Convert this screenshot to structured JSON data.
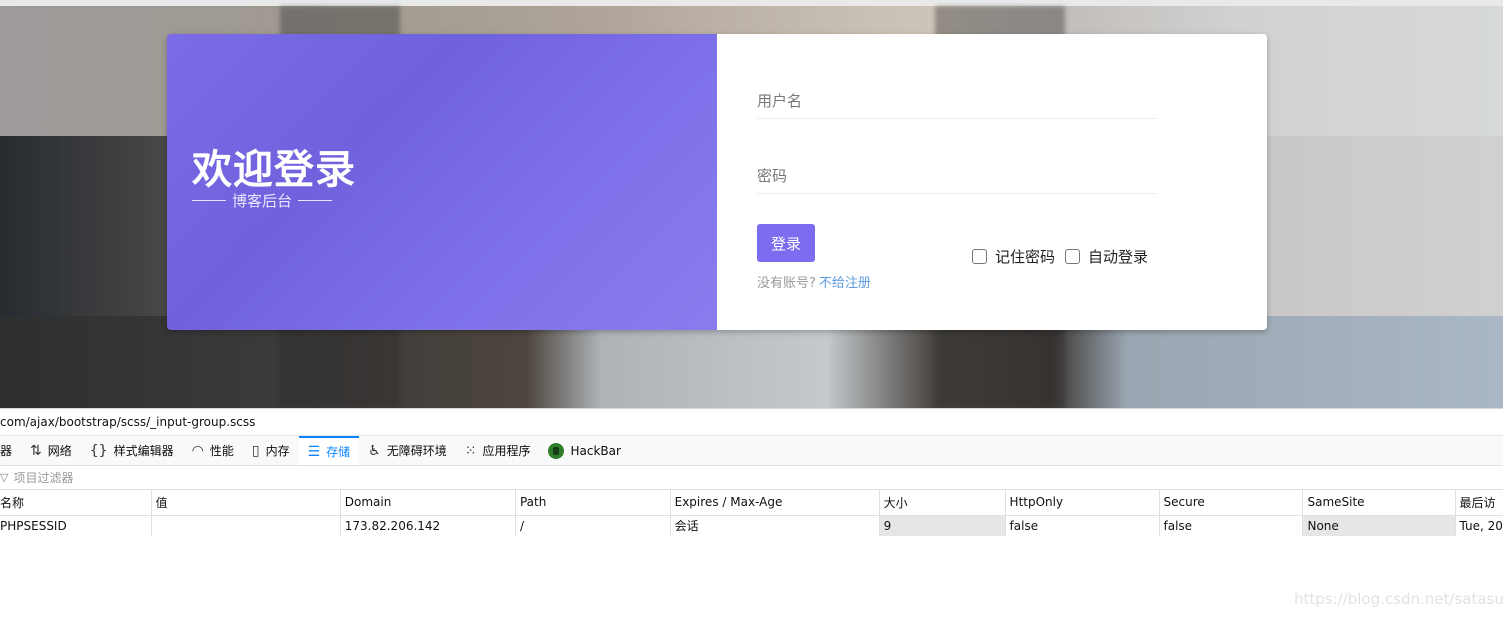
{
  "login": {
    "title": "欢迎登录",
    "subtitle": "博客后台",
    "username_placeholder": "用户名",
    "password_placeholder": "密码",
    "login_button": "登录",
    "remember_label": "记住密码",
    "auto_login_label": "自动登录",
    "no_account_text": "没有账号?",
    "register_link": "不给注册"
  },
  "devtools": {
    "url": "com/ajax/bootstrap/scss/_input-group.scss",
    "tabs": [
      {
        "label": "器",
        "icon": ""
      },
      {
        "label": "网络",
        "icon": "network-icon"
      },
      {
        "label": "样式编辑器",
        "icon": "style-editor-icon"
      },
      {
        "label": "性能",
        "icon": "performance-icon"
      },
      {
        "label": "内存",
        "icon": "memory-icon"
      },
      {
        "label": "存储",
        "icon": "storage-icon"
      },
      {
        "label": "无障碍环境",
        "icon": "accessibility-icon"
      },
      {
        "label": "应用程序",
        "icon": "application-icon"
      },
      {
        "label": "HackBar",
        "icon": "hackbar-icon"
      }
    ],
    "active_tab": "存储",
    "filter_placeholder": "项目过滤器",
    "columns": [
      "名称",
      "值",
      "Domain",
      "Path",
      "Expires / Max-Age",
      "大小",
      "HttpOnly",
      "Secure",
      "SameSite",
      "最后访"
    ],
    "rows": [
      [
        "PHPSESSID",
        "",
        "173.82.206.142",
        "/",
        "会话",
        "9",
        "false",
        "false",
        "None",
        "Tue, 20"
      ]
    ]
  },
  "watermark": "https://blog.csdn.net/satasun",
  "colors": {
    "accent_purple": "#7c6df0",
    "link_blue": "#5c9be0",
    "devtools_active_tab": "#0a84ff"
  }
}
